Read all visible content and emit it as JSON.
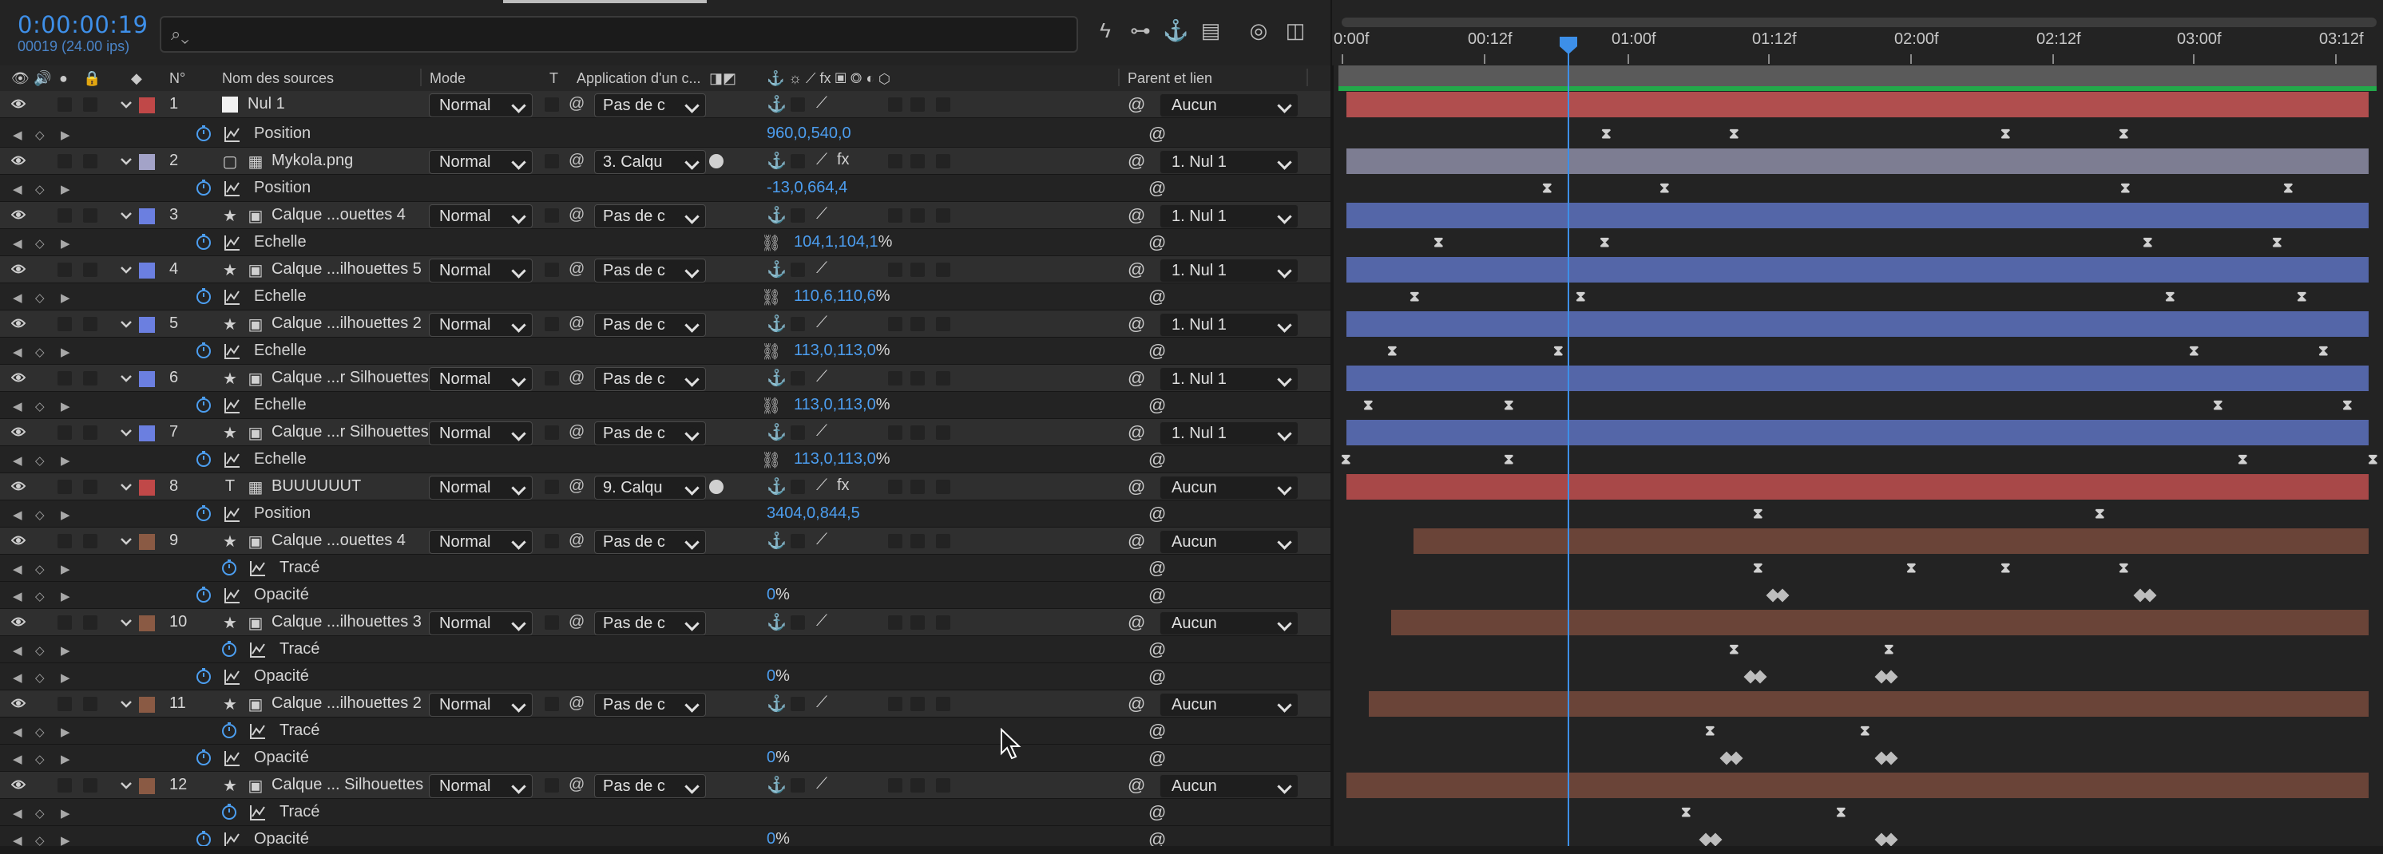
{
  "header": {
    "timecode": "0:00:00:19",
    "fps_info": "00019 (24.00 ips)",
    "search_placeholder": ""
  },
  "columns": {
    "num": "N°",
    "source_name": "Nom des sources",
    "mode": "Mode",
    "t": "T",
    "track_matte": "Application d'un c...",
    "parent": "Parent et lien"
  },
  "ruler": {
    "ticks": [
      "0:00f",
      "00:12f",
      "01:00f",
      "01:12f",
      "02:00f",
      "02:12f",
      "03:00f",
      "03:12f"
    ]
  },
  "layers": [
    {
      "num": "1",
      "type": "null",
      "name": "Nul 1",
      "mode": "Normal",
      "track": "Pas de c",
      "parent": "Aucun",
      "label": "#c04848",
      "bar": "#b04e4e"
    },
    {
      "prop": "Position",
      "value": "960,0,540,0"
    },
    {
      "num": "2",
      "type": "footage",
      "name": "Mykola.png",
      "mode": "Normal",
      "track": "3. Calqu",
      "parent": "1. Nul 1",
      "label": "#a3a3c8",
      "bar": "#7d7d92"
    },
    {
      "prop": "Position",
      "value": "-13,0,664,4"
    },
    {
      "num": "3",
      "type": "shape",
      "name": "Calque ...ouettes 4",
      "mode": "Normal",
      "track": "Pas de c",
      "parent": "1. Nul 1",
      "label": "#6b7fe0",
      "bar": "#5466a8"
    },
    {
      "prop": "Echelle",
      "value": "104,1,104,1",
      "pct": "%"
    },
    {
      "num": "4",
      "type": "shape",
      "name": "Calque ...ilhouettes 5",
      "mode": "Normal",
      "track": "Pas de c",
      "parent": "1. Nul 1",
      "label": "#6b7fe0",
      "bar": "#5466a8"
    },
    {
      "prop": "Echelle",
      "value": "110,6,110,6",
      "pct": "%"
    },
    {
      "num": "5",
      "type": "shape",
      "name": "Calque ...ilhouettes 2",
      "mode": "Normal",
      "track": "Pas de c",
      "parent": "1. Nul 1",
      "label": "#6b7fe0",
      "bar": "#5466a8"
    },
    {
      "prop": "Echelle",
      "value": "113,0,113,0",
      "pct": "%"
    },
    {
      "num": "6",
      "type": "shape",
      "name": "Calque ...r Silhouettes",
      "mode": "Normal",
      "track": "Pas de c",
      "parent": "1. Nul 1",
      "label": "#6b7fe0",
      "bar": "#5466a8"
    },
    {
      "prop": "Echelle",
      "value": "113,0,113,0",
      "pct": "%"
    },
    {
      "num": "7",
      "type": "shape",
      "name": "Calque ...r Silhouettes",
      "mode": "Normal",
      "track": "Pas de c",
      "parent": "1. Nul 1",
      "label": "#6b7fe0",
      "bar": "#5466a8"
    },
    {
      "prop": "Echelle",
      "value": "113,0,113,0",
      "pct": "%"
    },
    {
      "num": "8",
      "type": "text",
      "name": "BUUUUUUT",
      "mode": "Normal",
      "track": "9. Calqu",
      "parent": "Aucun",
      "label": "#c04848",
      "bar": "#a84848"
    },
    {
      "prop": "Position",
      "value": "3404,0,844,5"
    },
    {
      "num": "9",
      "type": "shape",
      "name": "Calque ...ouettes 4",
      "mode": "Normal",
      "track": "Pas de c",
      "parent": "Aucun",
      "label": "#8a5a44",
      "bar": "#6a4438"
    },
    {
      "prop": "Tracé",
      "value": "",
      "indent": true
    },
    {
      "prop": "Opacité",
      "value": "0",
      "pct": "%"
    },
    {
      "num": "10",
      "type": "shape",
      "name": "Calque ...ilhouettes 3",
      "mode": "Normal",
      "track": "Pas de c",
      "parent": "Aucun",
      "label": "#8a5a44",
      "bar": "#6a4438"
    },
    {
      "prop": "Tracé",
      "value": "",
      "indent": true
    },
    {
      "prop": "Opacité",
      "value": "0",
      "pct": "%"
    },
    {
      "num": "11",
      "type": "shape",
      "name": "Calque ...ilhouettes 2",
      "mode": "Normal",
      "track": "Pas de c",
      "parent": "Aucun",
      "label": "#8a5a44",
      "bar": "#6a4438"
    },
    {
      "prop": "Tracé",
      "value": "",
      "indent": true
    },
    {
      "prop": "Opacité",
      "value": "0",
      "pct": "%"
    },
    {
      "num": "12",
      "type": "shape",
      "name": "Calque ... Silhouettes",
      "mode": "Normal",
      "track": "Pas de c",
      "parent": "Aucun",
      "label": "#8a5a44",
      "bar": "#6a4438"
    },
    {
      "prop": "Tracé",
      "value": "",
      "indent": true
    },
    {
      "prop": "Opacité",
      "value": "0",
      "pct": "%"
    }
  ],
  "colors": {
    "accent": "#3d8fe8",
    "value_blue": "#4c9ef0",
    "work_area_green": "#23a84a"
  }
}
